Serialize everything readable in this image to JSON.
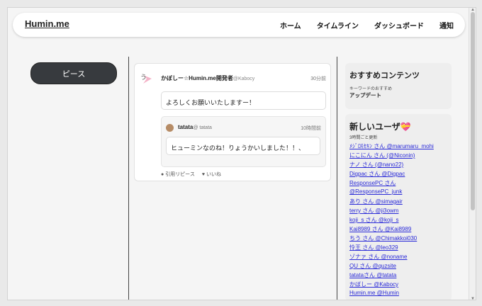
{
  "header": {
    "brand": "Humin.me",
    "nav": [
      "ホーム",
      "タイムライン",
      "ダッシュボード",
      "通知"
    ]
  },
  "sidebar": {
    "peace_button": "ピース"
  },
  "post": {
    "author_name": "かぼしー☆Humin.me開発者",
    "author_handle": "@Kabocy",
    "time": "30分前",
    "text": "よろしくお願いいたしますー！",
    "quote": {
      "author_name": "tatata",
      "author_handle": "@ tatata",
      "time": "10時間前",
      "text": "ヒューミンなのね！りょうかいしました！！、"
    },
    "actions": {
      "repiece": "引用リピース",
      "like": "いいね"
    }
  },
  "recommend": {
    "title": "おすすめコンテンツ",
    "subtitle": "キーワードのおすすめ",
    "item": "アップデート"
  },
  "new_users": {
    "title": "新しいユーザ💝",
    "subtitle": "3時間ごと更新",
    "users": [
      "ﾒｼﾞﾛﾓｾｷﾝ さん @marumaru_mohi",
      "にこにん さん (@Niconin)",
      "ナノ さん (@nano22)",
      "Digpac さん @Digpac",
      "ResponsePC さん",
      "@ResponsePC_junk",
      "あり さん @simagair",
      "terry さん @ji3owm",
      "koji_s さん @koji_s",
      "Kai8989 さん @Kai8989",
      "ちう さん @Chimakkoi030",
      "怜王 さん @leo329",
      "ゾナァ さん @noname",
      "QU さん @quzsite",
      "tatataさん @tatata",
      "かぼしー @Kabocy",
      "Humin.me @Humin"
    ]
  }
}
